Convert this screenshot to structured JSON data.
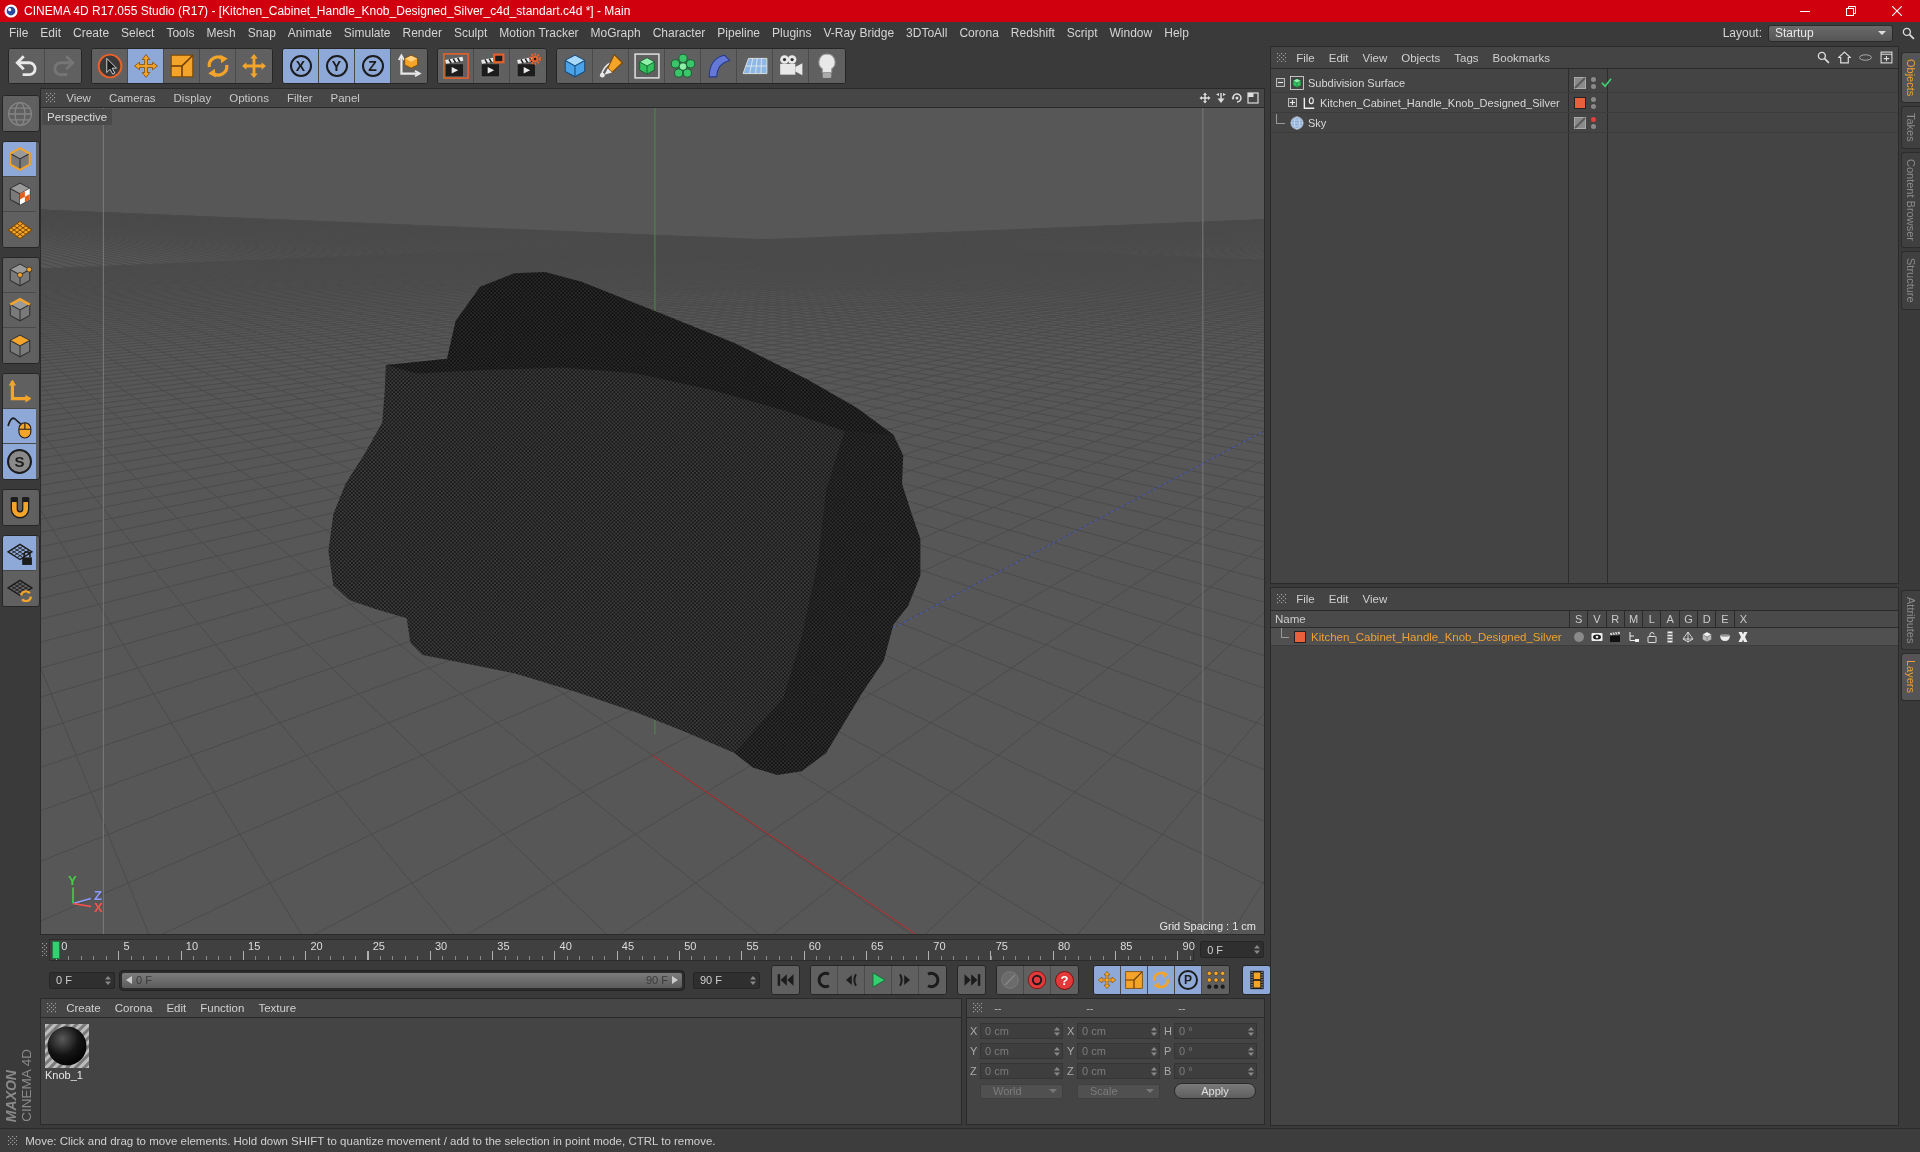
{
  "window": {
    "title": "CINEMA 4D R17.055 Studio (R17) - [Kitchen_Cabinet_Handle_Knob_Designed_Silver_c4d_standart.c4d *] - Main"
  },
  "menu_bar": {
    "items": [
      "File",
      "Edit",
      "Create",
      "Select",
      "Tools",
      "Mesh",
      "Snap",
      "Animate",
      "Simulate",
      "Render",
      "Sculpt",
      "Motion Tracker",
      "MoGraph",
      "Character",
      "Pipeline",
      "Plugins",
      "V-Ray Bridge",
      "3DToAll",
      "Corona",
      "Redshift",
      "Script",
      "Window",
      "Help"
    ],
    "layout_label": "Layout:",
    "layout_value": "Startup"
  },
  "toolbar": {
    "groups": [
      [
        {
          "on": false,
          "disabled": false
        },
        {
          "on": false,
          "disabled": true
        }
      ],
      [
        {
          "on": false
        },
        {
          "on": true
        },
        {
          "on": false
        },
        {
          "on": false
        },
        {
          "on": false
        }
      ],
      [
        {
          "label": "X",
          "on": true
        },
        {
          "label": "Y",
          "on": true
        },
        {
          "label": "Z",
          "on": true
        },
        {
          "on": false
        }
      ],
      [
        {
          "on": false
        },
        {
          "on": false
        },
        {
          "on": false
        }
      ],
      [
        {
          "on": false
        },
        {
          "on": false
        },
        {
          "on": false
        },
        {
          "on": false
        },
        {
          "on": false
        },
        {
          "on": false
        },
        {
          "on": false
        },
        {
          "on": false
        }
      ]
    ]
  },
  "left_toolbar": {
    "groups": [
      [
        {
          "on": false,
          "disabled": true
        }
      ],
      [
        {
          "on": true
        },
        {
          "on": false
        },
        {
          "on": false
        }
      ],
      [
        {
          "on": false
        },
        {
          "on": false
        },
        {
          "on": false
        }
      ],
      [
        {
          "on": false
        },
        {
          "on": true
        },
        {
          "label": "S",
          "on": true
        }
      ],
      [
        {
          "on": false
        }
      ],
      [
        {
          "on": true
        },
        {
          "on": false
        }
      ]
    ]
  },
  "viewport": {
    "menu": [
      "View",
      "Cameras",
      "Display",
      "Options",
      "Filter",
      "Panel"
    ],
    "camera": "Perspective",
    "grid_spacing": "Grid Spacing : 1 cm",
    "gizmo_axes": [
      {
        "label": "Y",
        "color": "#44d044"
      },
      {
        "label": "Z",
        "color": "#8c9aff"
      },
      {
        "label": "X",
        "color": "#ff5050"
      }
    ]
  },
  "timeline": {
    "ticks": [
      "0",
      "5",
      "10",
      "15",
      "20",
      "25",
      "30",
      "35",
      "40",
      "45",
      "50",
      "55",
      "60",
      "65",
      "70",
      "75",
      "80",
      "85",
      "90"
    ],
    "playhead": {
      "level": 0
    },
    "frame_field": "0 F"
  },
  "playback": {
    "start_field": "0 F",
    "range": {
      "level": 1,
      "start": "0 F",
      "end": "90 F"
    },
    "end_field": "90 F",
    "groups": [
      [
        {
          "on": false
        }
      ],
      [
        {
          "on": false
        },
        {
          "on": false
        },
        {
          "on": false
        },
        {
          "on": false
        },
        {
          "on": false
        }
      ],
      [
        {
          "on": false
        }
      ],
      [
        {
          "on": false,
          "disabled": true
        },
        {
          "on": false
        },
        {
          "label": "?",
          "on": false
        }
      ],
      [
        {
          "on": true
        },
        {
          "on": true
        },
        {
          "on": true
        },
        {
          "label": "P",
          "on": true
        },
        {
          "on": false
        }
      ],
      [
        {
          "on": true
        }
      ]
    ]
  },
  "material_manager": {
    "menu": [
      "Create",
      "Corona",
      "Edit",
      "Function",
      "Texture"
    ],
    "materials": [
      {
        "name": "Knob_1",
        "selected": false
      }
    ]
  },
  "coordinates": {
    "headers": [
      "--",
      "--",
      "--"
    ],
    "rows": [
      {
        "position_axis": "X",
        "position": "0 cm",
        "size_axis": "X",
        "size": "0 cm",
        "rotation_axis": "H",
        "rotation": "0 °"
      },
      {
        "position_axis": "Y",
        "position": "0 cm",
        "size_axis": "Y",
        "size": "0 cm",
        "rotation_axis": "P",
        "rotation": "0 °"
      },
      {
        "position_axis": "Z",
        "position": "0 cm",
        "size_axis": "Z",
        "size": "0 cm",
        "rotation_axis": "B",
        "rotation": "0 °"
      }
    ],
    "coordinate_mode": "World",
    "size_mode": "Scale",
    "apply": "Apply"
  },
  "object_manager": {
    "menu": [
      "File",
      "Edit",
      "View",
      "Objects",
      "Tags",
      "Bookmarks"
    ],
    "objects": [
      {
        "name": "Subdivision Surface",
        "kind": "subdivision",
        "selected": false,
        "expanded": true,
        "enabled": true,
        "editor_visible": true,
        "children": [
          {
            "name": "Kitchen_Cabinet_Handle_Knob_Designed_Silver",
            "kind": "null",
            "selected": false,
            "expanded": false,
            "editor_visible": true,
            "color": "#e8603c"
          }
        ]
      },
      {
        "name": "Sky",
        "kind": "sky",
        "selected": false,
        "editor_visible": false
      }
    ]
  },
  "layer_manager": {
    "menu": [
      "File",
      "Edit",
      "View"
    ],
    "columns": [
      "Name",
      "S",
      "V",
      "R",
      "M",
      "L",
      "A",
      "G",
      "D",
      "E",
      "X"
    ],
    "layers": [
      {
        "name": "Kitchen_Cabinet_Handle_Knob_Designed_Silver",
        "color": "#e8603c",
        "selected": true
      }
    ]
  },
  "side_tabs": {
    "upper": [
      {
        "label": "Objects",
        "selected": true
      },
      {
        "label": "Takes",
        "selected": false
      },
      {
        "label": "Content Browser",
        "selected": false
      },
      {
        "label": "Structure",
        "selected": false
      }
    ],
    "lower": [
      {
        "label": "Attributes",
        "selected": false
      },
      {
        "label": "Layers",
        "selected": true
      }
    ]
  },
  "logo": {
    "brand": "MAXON",
    "product": "CINEMA 4D"
  },
  "status_bar": {
    "text": "Move: Click and drag to move elements. Hold down SHIFT to quantize movement / add to the selection in point mode, CTRL to remove."
  }
}
